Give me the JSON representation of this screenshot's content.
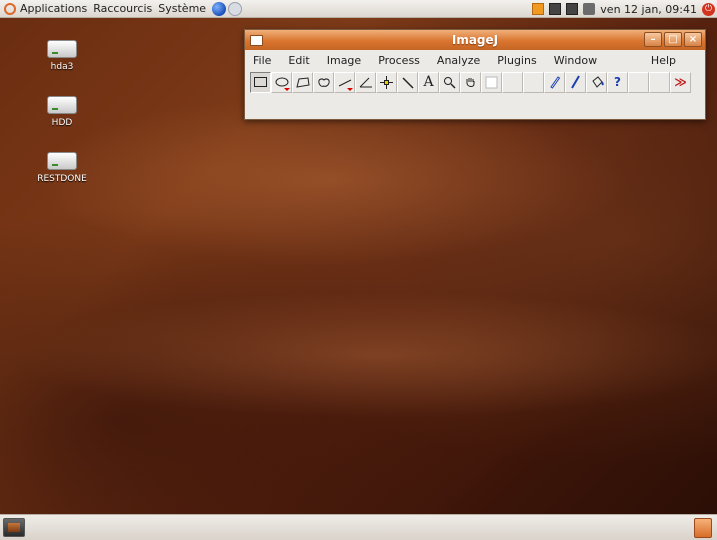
{
  "top_panel": {
    "menus": [
      "Applications",
      "Raccourcis",
      "Système"
    ],
    "clock": "ven 12 jan, 09:41"
  },
  "desktop": {
    "icons": [
      {
        "label": "hda3"
      },
      {
        "label": "HDD"
      },
      {
        "label": "RESTDONE"
      }
    ]
  },
  "imagej": {
    "title": "ImageJ",
    "menu": [
      "File",
      "Edit",
      "Image",
      "Process",
      "Analyze",
      "Plugins",
      "Window"
    ],
    "help": "Help",
    "tools": {
      "text": "A",
      "help": "?",
      "more": "≫"
    }
  },
  "colors": {
    "accent": "#d9752f",
    "desktop_bg": "#6a2c10"
  }
}
